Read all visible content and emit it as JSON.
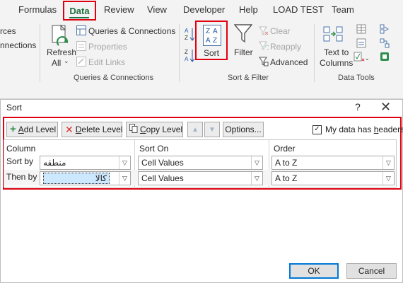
{
  "ribbon": {
    "tabs": [
      "Formulas",
      "Data",
      "Review",
      "View",
      "Developer",
      "Help",
      "LOAD TEST",
      "Team"
    ],
    "connections_partial": [
      "rces",
      "nnections"
    ],
    "refresh_all": [
      "Refresh",
      "All"
    ],
    "queries": {
      "queries_connections": "Queries & Connections",
      "properties": "Properties",
      "edit_links": "Edit Links",
      "group_label": "Queries & Connections"
    },
    "sort_filter": {
      "sort": "Sort",
      "filter": "Filter",
      "clear": "Clear",
      "reapply": "Reapply",
      "advanced": "Advanced",
      "group_label": "Sort & Filter"
    },
    "data_tools": {
      "text_to_columns": [
        "Text to",
        "Columns"
      ],
      "group_label": "Data Tools"
    }
  },
  "dialog": {
    "title": "Sort",
    "help": "?",
    "close": "✕",
    "toolbar": {
      "add_level": {
        "u": "A",
        "rest": "dd Level"
      },
      "delete_level": {
        "u": "D",
        "rest": "elete Level"
      },
      "copy_level": {
        "u": "C",
        "rest": "opy Level"
      },
      "options": "Options...",
      "headers_checkbox": {
        "pre": "My data has ",
        "u": "h",
        "rest": "eaders",
        "checked": true
      }
    },
    "columns": {
      "column": "Column",
      "sort_on": "Sort On",
      "order": "Order"
    },
    "rows": [
      {
        "label": "Sort by",
        "column": "منطقه",
        "sort_on": "Cell Values",
        "order": "A to Z"
      },
      {
        "label": "Then by",
        "column": "كالا",
        "sort_on": "Cell Values",
        "order": "A to Z"
      }
    ],
    "ok": "OK",
    "cancel": "Cancel"
  },
  "colors": {
    "highlight_red": "#e1000f",
    "excel_green": "#217346",
    "selection_blue": "#cce8ff"
  }
}
